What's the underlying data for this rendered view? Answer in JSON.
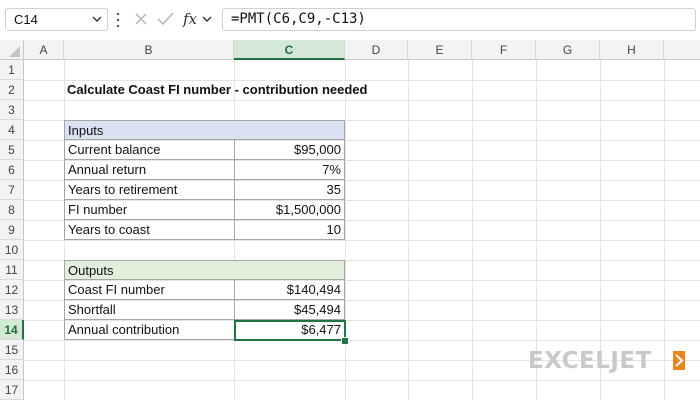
{
  "formula_bar": {
    "name_box": "C14",
    "formula": "=PMT(C6,C9,-C13)",
    "fx_label": "fx"
  },
  "columns": [
    "A",
    "B",
    "C",
    "D",
    "E",
    "F",
    "G",
    "H"
  ],
  "selected_column": "C",
  "rows": [
    "1",
    "2",
    "3",
    "4",
    "5",
    "6",
    "7",
    "8",
    "9",
    "10",
    "11",
    "12",
    "13",
    "14",
    "15",
    "16",
    "17"
  ],
  "selected_row": "14",
  "sheet": {
    "title": "Calculate Coast FI number - contribution needed",
    "inputs_header": "Inputs",
    "inputs": [
      {
        "label": "Current balance",
        "value": "$95,000"
      },
      {
        "label": "Annual return",
        "value": "7%"
      },
      {
        "label": "Years to retirement",
        "value": "35"
      },
      {
        "label": "FI number",
        "value": "$1,500,000"
      },
      {
        "label": "Years to coast",
        "value": "10"
      }
    ],
    "outputs_header": "Outputs",
    "outputs": [
      {
        "label": "Coast FI number",
        "value": "$140,494"
      },
      {
        "label": "Shortfall",
        "value": "$45,494"
      },
      {
        "label": "Annual contribution",
        "value": "$6,477"
      }
    ]
  },
  "brand": {
    "logo_text": "EXCELJET",
    "accent_color": "#e8861c",
    "logo_gray": "#c9c9c9"
  },
  "colors": {
    "selection_green": "#217346",
    "inputs_header_bg": "#d9e1f2",
    "outputs_header_bg": "#e2efda"
  }
}
